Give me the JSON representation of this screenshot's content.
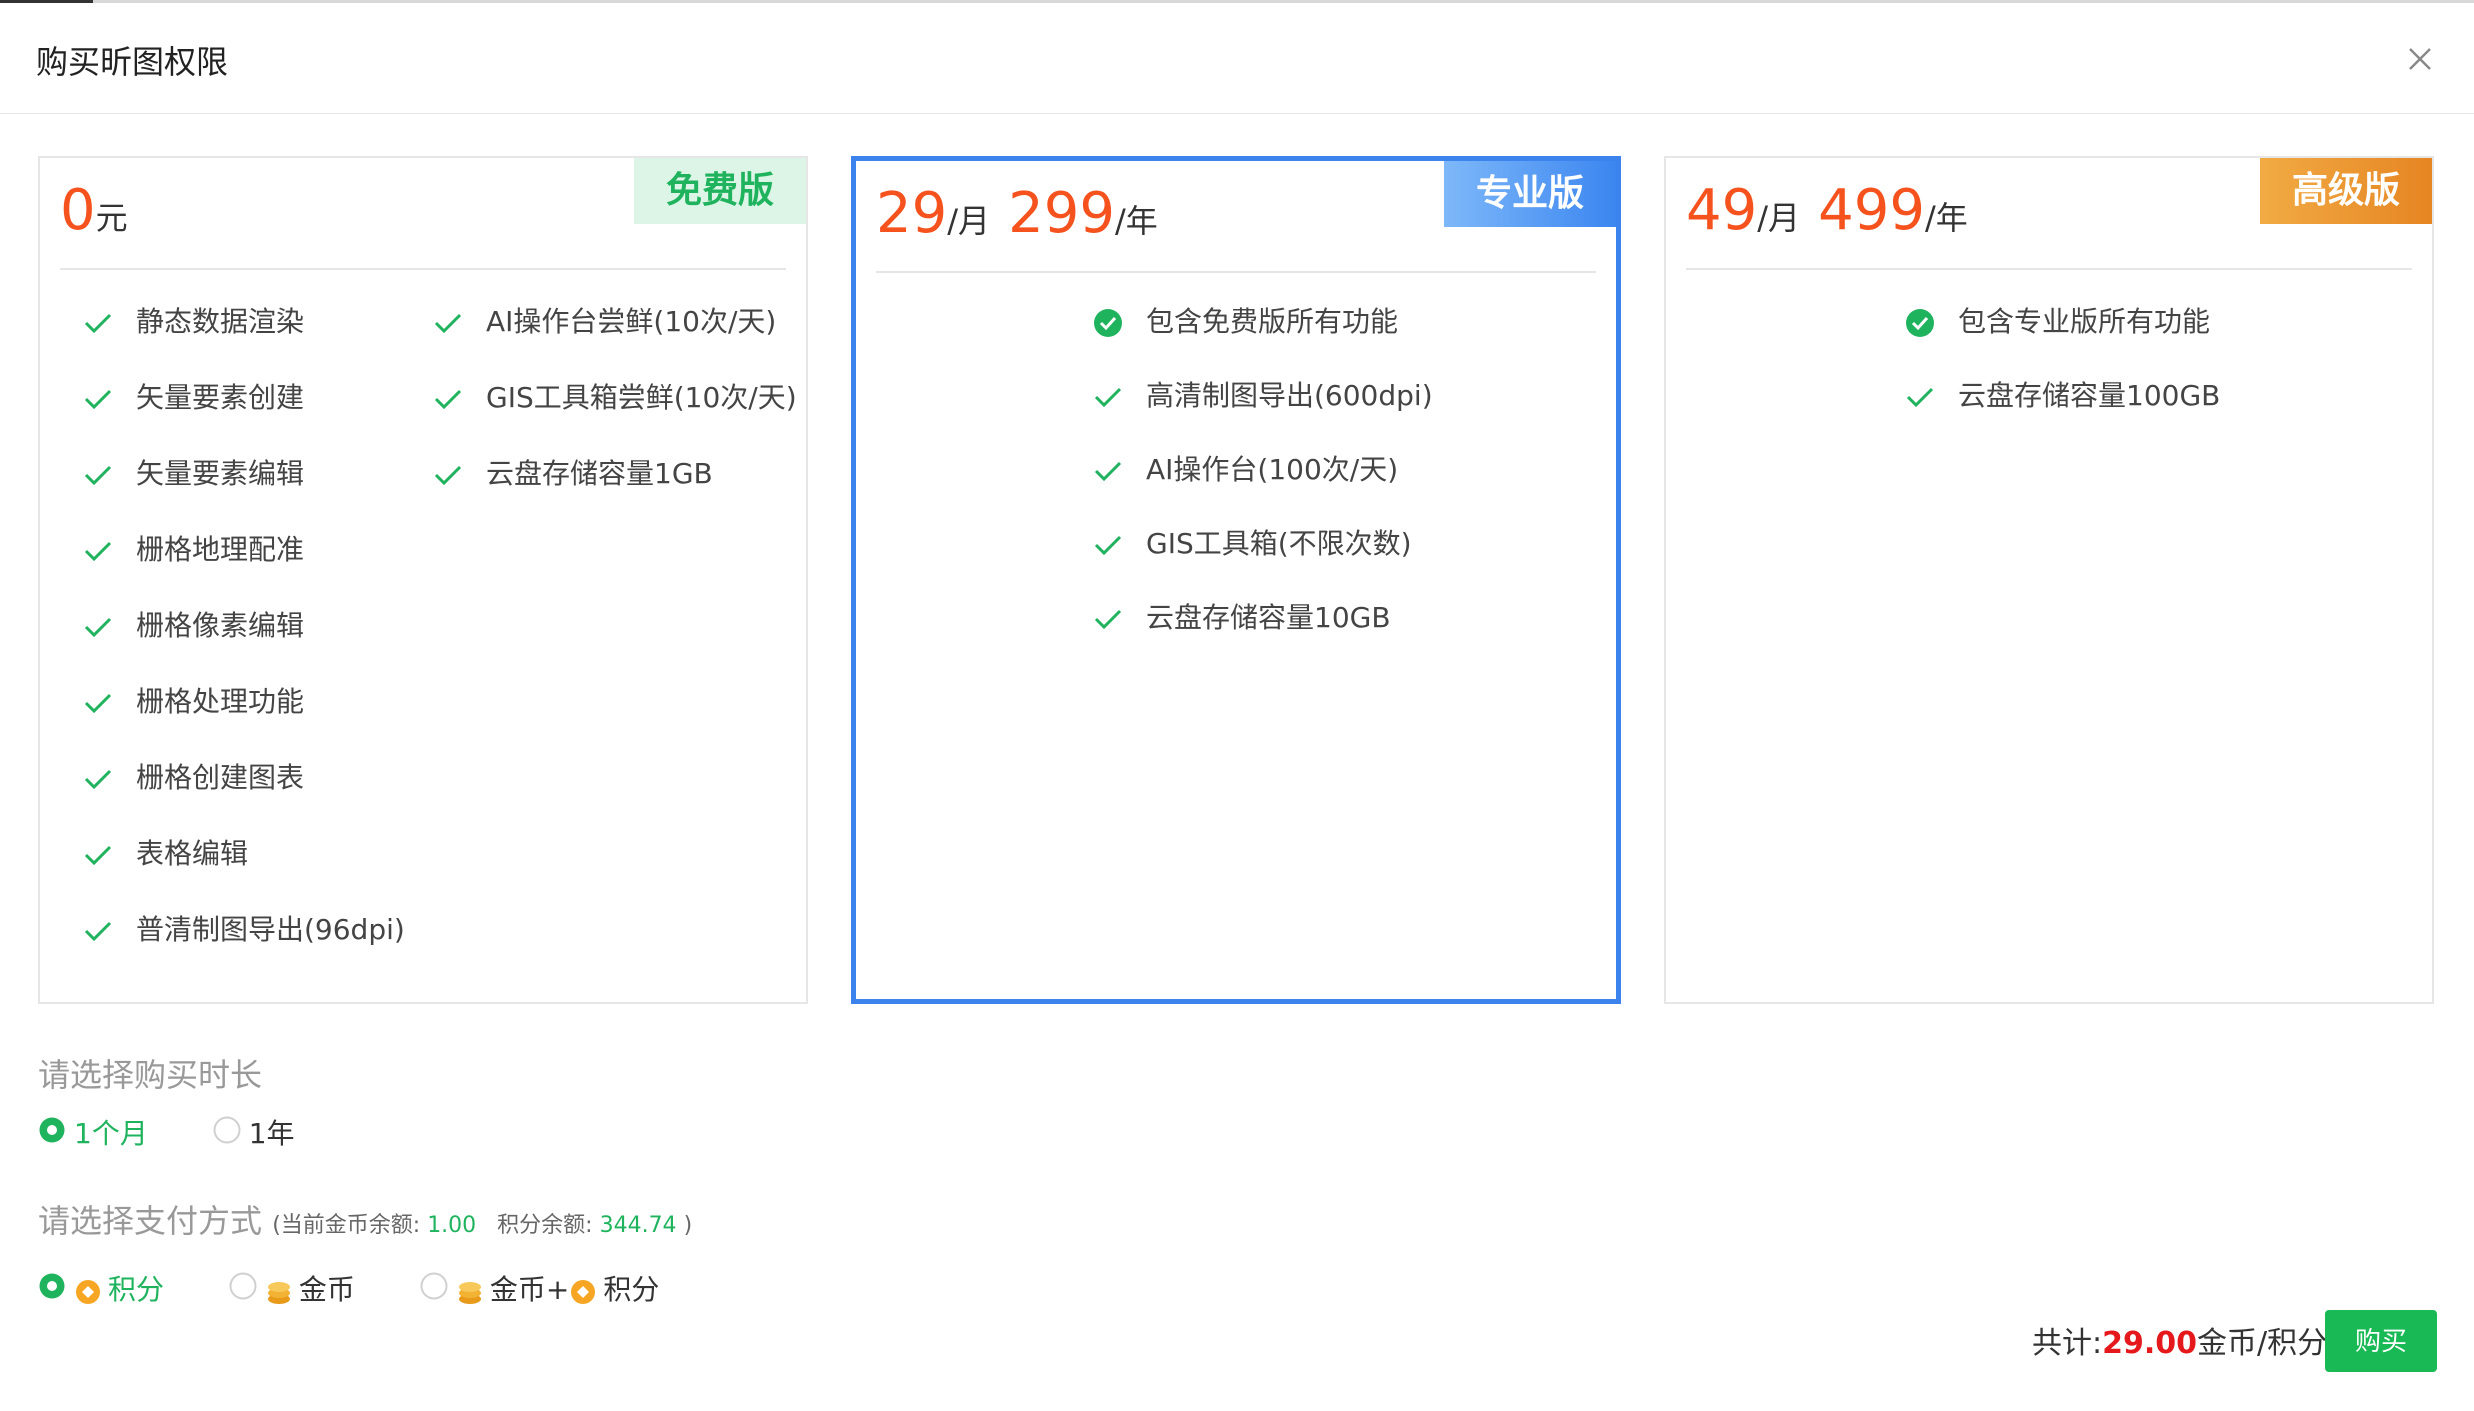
{
  "dialog": {
    "title": "购买昕图权限"
  },
  "plans": [
    {
      "badge": "免费版",
      "price": {
        "amount": "0",
        "unit": "元"
      },
      "features_left": [
        "静态数据渲染",
        "矢量要素创建",
        "矢量要素编辑",
        "栅格地理配准",
        "栅格像素编辑",
        "栅格处理功能",
        "栅格创建图表",
        "表格编辑",
        "普清制图导出(96dpi)"
      ],
      "features_right": [
        "AI操作台尝鲜(10次/天)",
        "GIS工具箱尝鲜(10次/天)",
        "云盘存储容量1GB"
      ]
    },
    {
      "badge": "专业版",
      "price": {
        "month": "29",
        "month_unit": "/月",
        "year": "299",
        "year_unit": "/年"
      },
      "features": [
        "包含免费版所有功能",
        "高清制图导出(600dpi)",
        "AI操作台(100次/天)",
        "GIS工具箱(不限次数)",
        "云盘存储容量10GB"
      ]
    },
    {
      "badge": "高级版",
      "price": {
        "month": "49",
        "month_unit": "/月",
        "year": "499",
        "year_unit": "/年"
      },
      "features": [
        "包含专业版所有功能",
        "云盘存储容量100GB"
      ]
    }
  ],
  "duration": {
    "label": "请选择购买时长",
    "options": [
      "1个月",
      "1年"
    ],
    "selected": "1个月"
  },
  "payment": {
    "label": "请选择支付方式",
    "hint_open": "(当前金币余额:",
    "coin_balance": "1.00",
    "points_label": "积分余额:",
    "points_balance": "344.74",
    "hint_close": ")",
    "options": [
      "积分",
      "金币",
      "金币+",
      "积分"
    ],
    "selected": "积分"
  },
  "footer": {
    "total_label": "共计:",
    "total_amount": "29.00",
    "total_unit": "金币/积分",
    "buy_label": "购买"
  },
  "colors": {
    "accent_green": "#1fb35d",
    "price_orange": "#f5521e",
    "selected_blue": "#3c83ee",
    "total_red": "#e5181c"
  }
}
